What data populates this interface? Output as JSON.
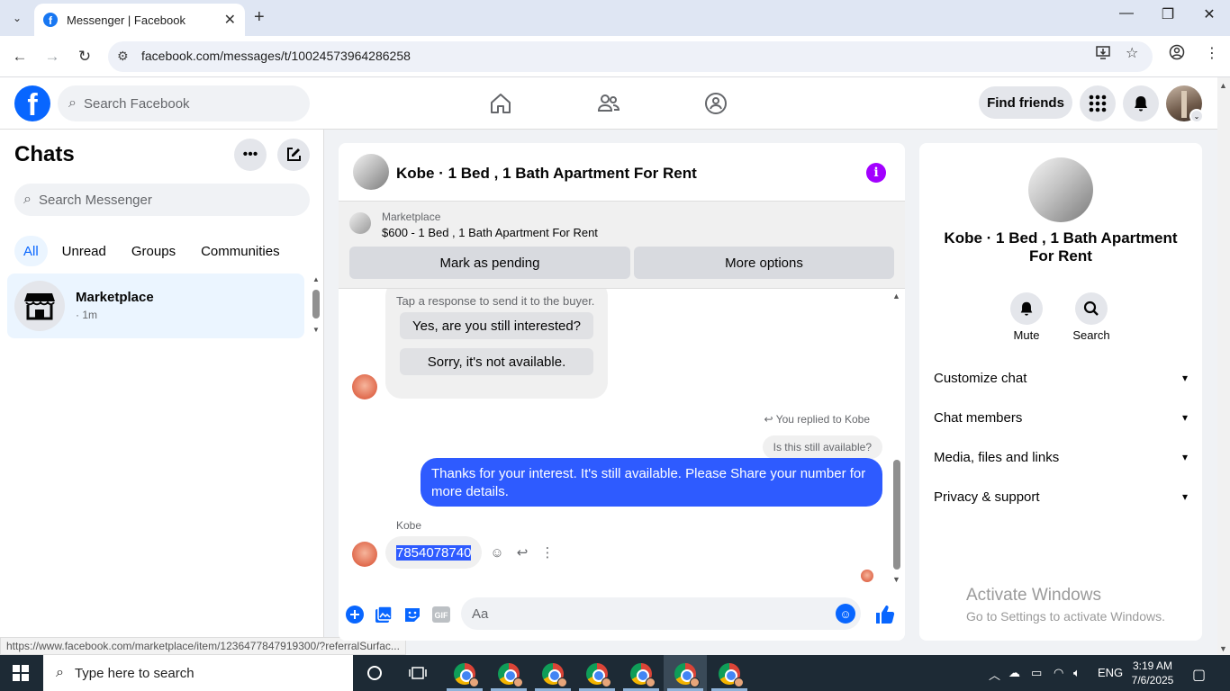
{
  "browser": {
    "tab_title": "Messenger | Facebook",
    "url": "facebook.com/messages/t/10024573964286258",
    "status_url": "https://www.facebook.com/marketplace/item/1236477847919300/?referralSurfac..."
  },
  "fb_header": {
    "search_placeholder": "Search Facebook",
    "find_friends": "Find friends"
  },
  "left": {
    "title": "Chats",
    "search_placeholder": "Search Messenger",
    "filters": [
      "All",
      "Unread",
      "Groups",
      "Communities"
    ],
    "chat": {
      "name": "Marketplace",
      "time": "· 1m"
    }
  },
  "chat": {
    "title": "Kobe · 1 Bed , 1 Bath Apartment For Rent",
    "marketplace_label": "Marketplace",
    "listing": "$600 - 1 Bed , 1 Bath Apartment For Rent",
    "mark_pending": "Mark as pending",
    "more_options": "More options",
    "hint": "Tap a response to send it to the buyer.",
    "choice1": "Yes, are you still interested?",
    "choice2": "Sorry, it's not available.",
    "replied": "You replied to Kobe",
    "quoted": "Is this still available?",
    "outgoing": "Thanks for your interest.  It's still available. Please Share your number for more details.",
    "sender": "Kobe",
    "incoming": "7854078740",
    "composer_placeholder": "Aa"
  },
  "right": {
    "title": "Kobe · 1 Bed , 1 Bath Apartment For Rent",
    "mute": "Mute",
    "search": "Search",
    "rows": [
      "Customize chat",
      "Chat members",
      "Media, files and links",
      "Privacy & support"
    ],
    "activate_title": "Activate Windows",
    "activate_sub": "Go to Settings to activate Windows."
  },
  "taskbar": {
    "search_placeholder": "Type here to search",
    "lang": "ENG",
    "time": "3:19 AM",
    "date": "7/6/2025"
  },
  "colors": {
    "fb_blue": "#0866ff",
    "bubble_blue": "#2e5bff",
    "info_purple": "#a200ff"
  }
}
